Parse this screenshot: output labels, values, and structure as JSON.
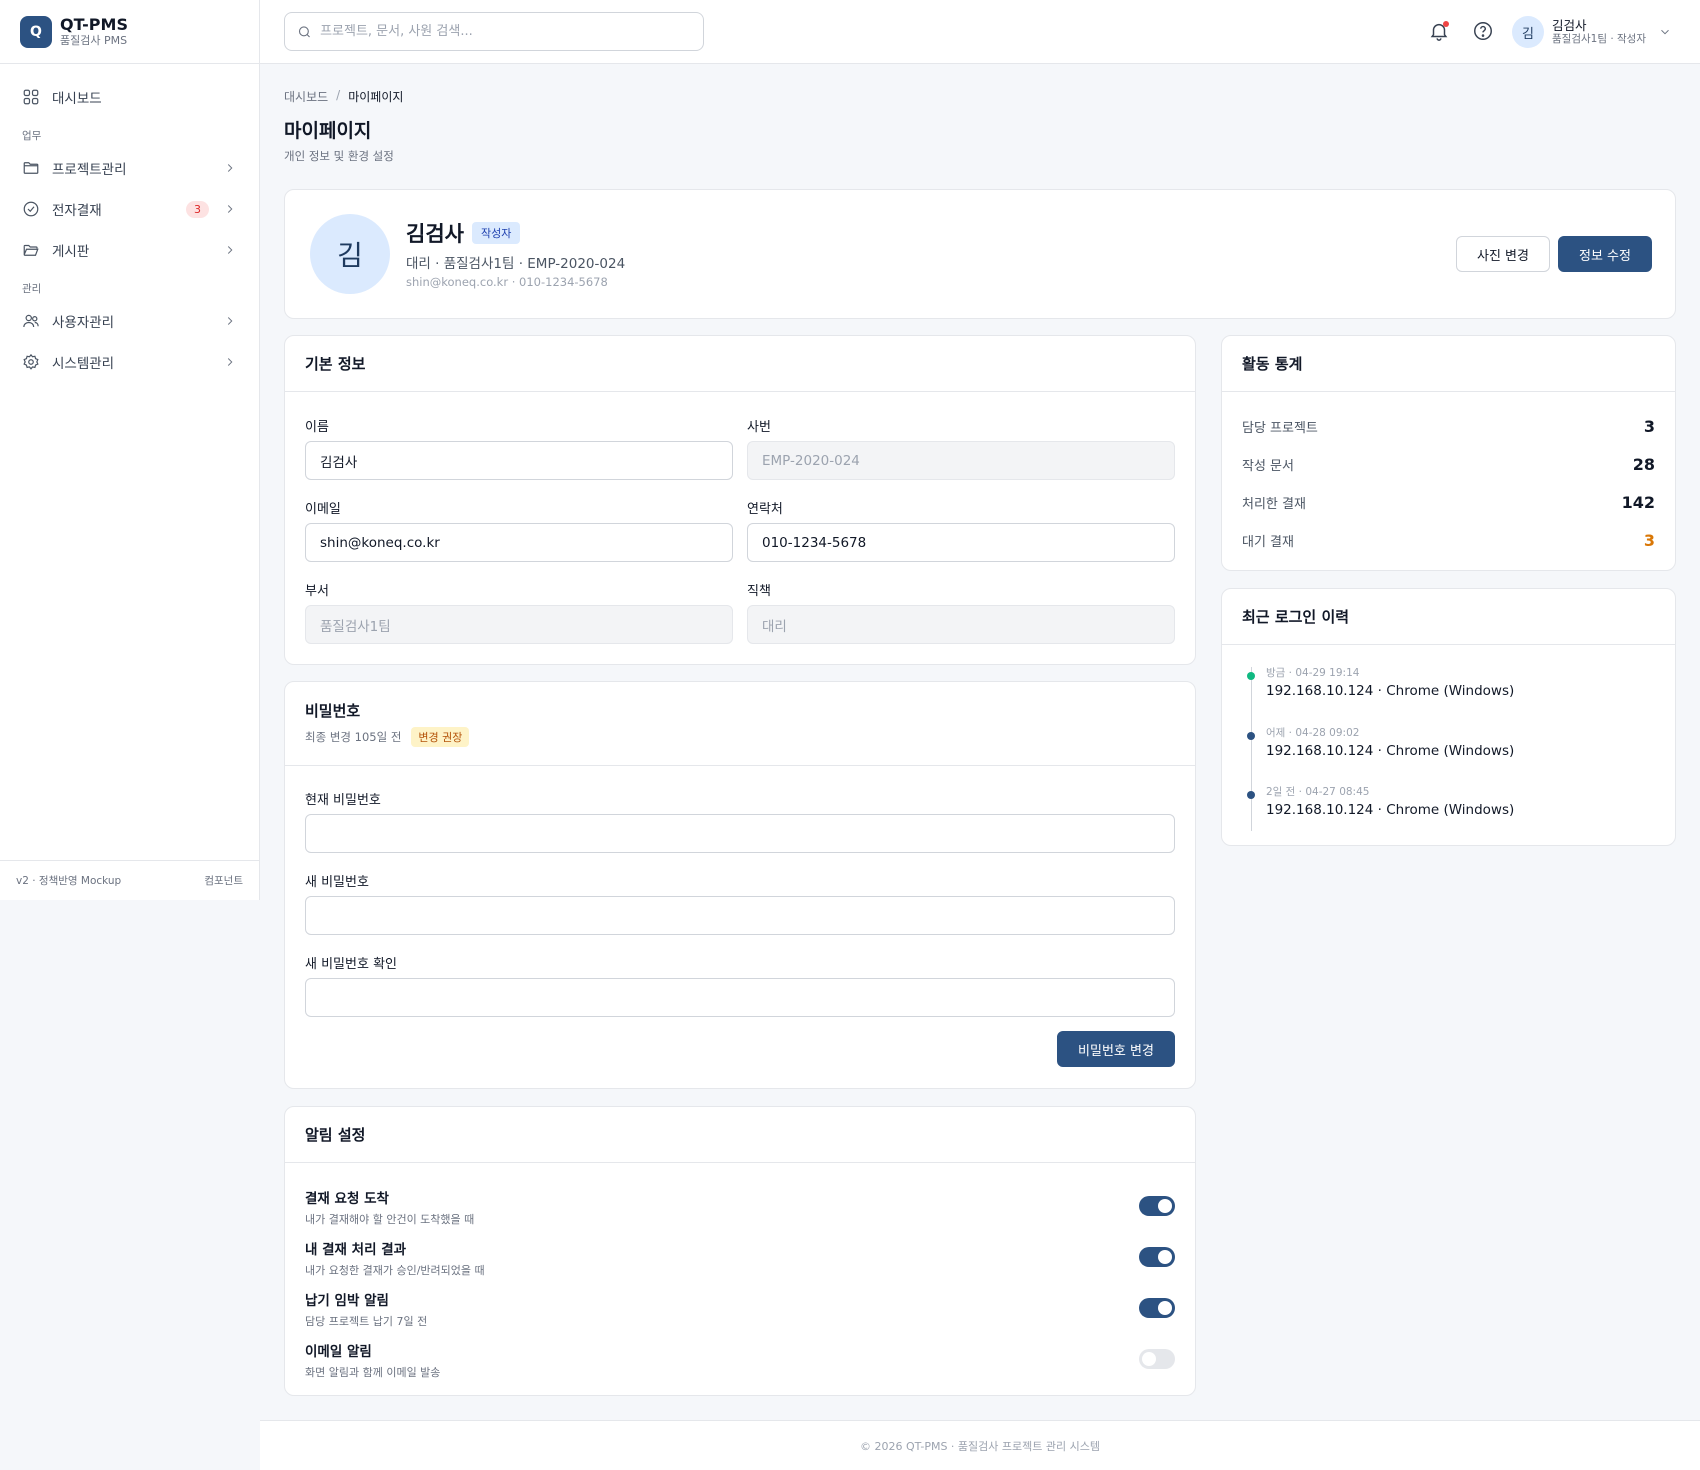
{
  "brand": {
    "logo": "Q",
    "name": "QT-PMS",
    "sub": "품질검사 PMS"
  },
  "sidebar": {
    "items": [
      {
        "label": "대시보드",
        "icon": "grid-icon"
      },
      {
        "section": "업무"
      },
      {
        "label": "프로젝트관리",
        "icon": "folder-icon"
      },
      {
        "label": "전자결재",
        "icon": "check-circle-icon",
        "badge": "3"
      },
      {
        "label": "게시판",
        "icon": "folder-open-icon"
      },
      {
        "section": "관리"
      },
      {
        "label": "사용자관리",
        "icon": "users-icon"
      },
      {
        "label": "시스템관리",
        "icon": "gear-icon"
      }
    ],
    "footer_left": "v2 · 정책반영 Mockup",
    "footer_right": "컴포넌트"
  },
  "header": {
    "search_placeholder": "프로젝트, 문서, 사원 검색...",
    "user": {
      "avatar": "김",
      "name": "김검사",
      "sub": "품질검사1팀 · 작성자"
    }
  },
  "breadcrumb": {
    "root": "대시보드",
    "sep": "/",
    "current": "마이페이지"
  },
  "page": {
    "title": "마이페이지",
    "subtitle": "개인 정보 및 환경 설정"
  },
  "profile": {
    "avatar": "김",
    "name": "김검사",
    "role": "작성자",
    "meta": "대리 · 품질검사1팀 · EMP-2020-024",
    "contact": "shin@koneq.co.kr · 010-1234-5678",
    "photo_button": "사진 변경",
    "edit_button": "정보 수정"
  },
  "basic_info": {
    "title": "기본 정보",
    "name_label": "이름",
    "name_value": "김검사",
    "empno_label": "사번",
    "empno_value": "EMP-2020-024",
    "email_label": "이메일",
    "email_value": "shin@koneq.co.kr",
    "phone_label": "연락처",
    "phone_value": "010-1234-5678",
    "dept_label": "부서",
    "dept_value": "품질검사1팀",
    "position_label": "직책",
    "position_value": "대리"
  },
  "password": {
    "title": "비밀번호",
    "last_changed": "최종 변경 105일 전",
    "badge": "변경 권장",
    "current_label": "현재 비밀번호",
    "new_label": "새 비밀번호",
    "confirm_label": "새 비밀번호 확인",
    "submit": "비밀번호 변경"
  },
  "notifications": {
    "title": "알림 설정",
    "items": [
      {
        "title": "결재 요청 도착",
        "desc": "내가 결재해야 할 안건이 도착했을 때",
        "on": true
      },
      {
        "title": "내 결재 처리 결과",
        "desc": "내가 요청한 결재가 승인/반려되었을 때",
        "on": true
      },
      {
        "title": "납기 임박 알림",
        "desc": "담당 프로젝트 납기 7일 전",
        "on": true
      },
      {
        "title": "이메일 알림",
        "desc": "화면 알림과 함께 이메일 발송",
        "on": false
      }
    ]
  },
  "stats": {
    "title": "활동 통계",
    "items": [
      {
        "label": "담당 프로젝트",
        "value": "3"
      },
      {
        "label": "작성 문서",
        "value": "28"
      },
      {
        "label": "처리한 결재",
        "value": "142"
      },
      {
        "label": "대기 결재",
        "value": "3",
        "accent": "#d97706"
      }
    ]
  },
  "logins": {
    "title": "최근 로그인 이력",
    "items": [
      {
        "when": "방금 · 04-29 19:14",
        "what": "192.168.10.124 · Chrome (Windows)"
      },
      {
        "when": "어제 · 04-28 09:02",
        "what": "192.168.10.124 · Chrome (Windows)"
      },
      {
        "when": "2일 전 · 04-27 08:45",
        "what": "192.168.10.124 · Chrome (Windows)"
      }
    ]
  },
  "footer": "© 2026 QT-PMS · 품질검사 프로젝트 관리 시스템",
  "colors": {
    "primary": "#2c5282",
    "danger": "#dc2626",
    "warning": "#d97706",
    "success": "#10b981"
  }
}
